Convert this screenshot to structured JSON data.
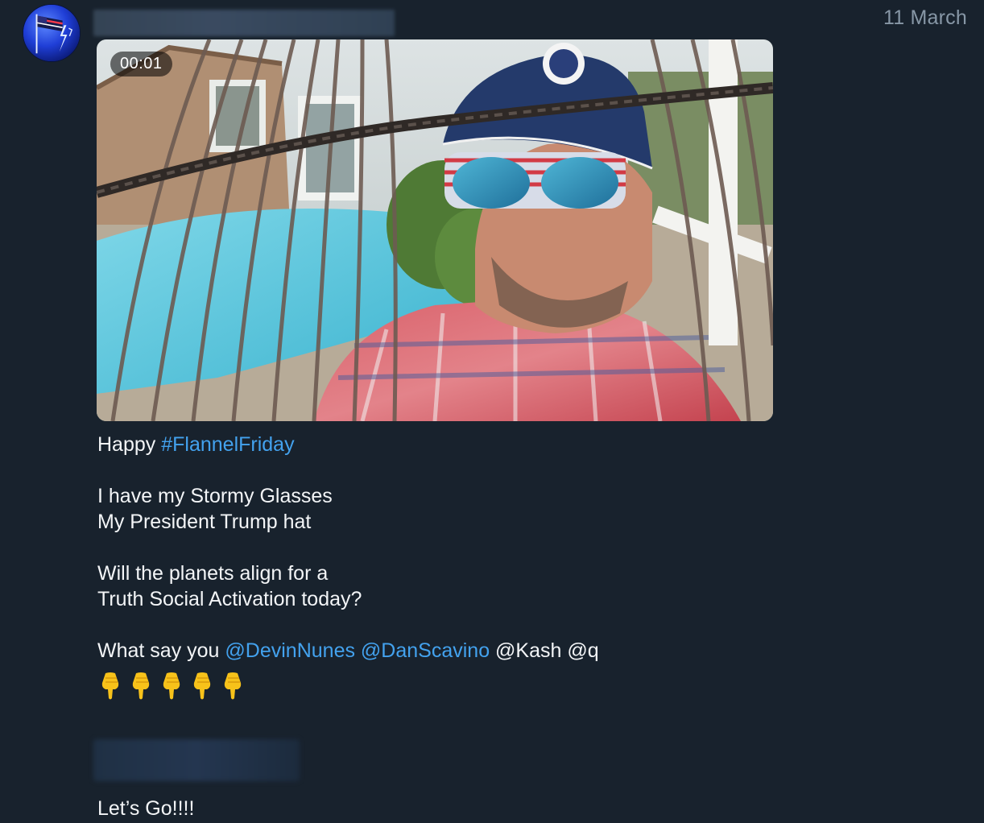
{
  "post": {
    "date": "11 March",
    "video": {
      "duration": "00:01"
    },
    "text": {
      "line1_prefix": "Happy ",
      "line1_hashtag": "#FlannelFriday",
      "line2": "I have my Stormy Glasses",
      "line3": "My President Trump hat",
      "line4": "Will the planets align for a",
      "line5": "Truth Social Activation today?",
      "line6_prefix": "What say you ",
      "mention1": "@DevinNunes",
      "mention2": "@DanScavino",
      "line6_suffix": " @Kash @q"
    },
    "emojis": [
      "pointing-down-emoji",
      "pointing-down-emoji",
      "pointing-down-emoji",
      "pointing-down-emoji",
      "pointing-down-emoji"
    ],
    "footer_text": "Let’s Go!!!!"
  },
  "colors": {
    "background": "#18222d",
    "link": "#43a2ee",
    "date": "#8797a6",
    "text": "#f3f5f7"
  }
}
